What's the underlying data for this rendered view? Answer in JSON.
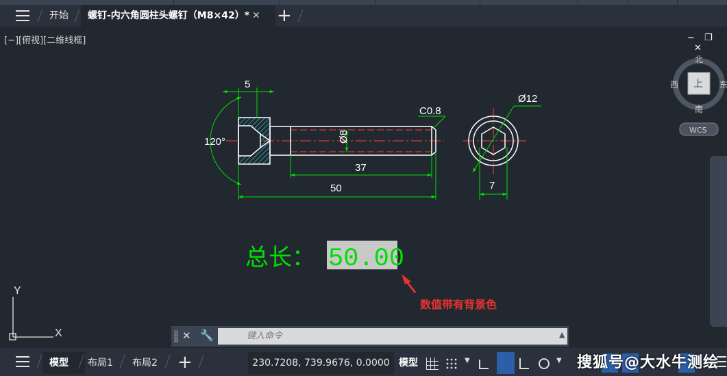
{
  "tabs": [
    {
      "label": "开始"
    },
    {
      "label": "螺钉-内六角圆柱头螺钉（M8×42）*",
      "close": "✕"
    }
  ],
  "add_tab": "+",
  "view_label": "[−][俯视][二维线框]",
  "window_buttons": [
    "−",
    "❐",
    "✕"
  ],
  "drawing": {
    "dim_head_width": "5",
    "dim_angle": "120°",
    "dim_chamfer": "C0.8",
    "dim_diameter": "Ø8",
    "dim_thread_length": "37",
    "dim_total_length": "50",
    "dim_circle_diameter": "Ø12",
    "dim_hex_width": "7",
    "total_label": "总长：",
    "total_value": "50.00",
    "line_color": "#ffffff",
    "dim_color": "#00e000",
    "center_color": "#ff3b3b",
    "hatch_color": "#33d6e6"
  },
  "annotation": "数值带有背景色",
  "viewcube": {
    "north": "北",
    "south": "南",
    "west": "西",
    "east": "东",
    "face": "上",
    "wcs": "WCS"
  },
  "ucs": {
    "x": "X",
    "y": "Y"
  },
  "command": {
    "placeholder": "键入命令"
  },
  "status": {
    "tabs": [
      "模型",
      "布局1",
      "布局2"
    ],
    "add": "+",
    "coords": "230.7208, 739.9676, 0.0000",
    "model_button": "模型"
  },
  "watermark": "搜狐号@大水牛测绘"
}
